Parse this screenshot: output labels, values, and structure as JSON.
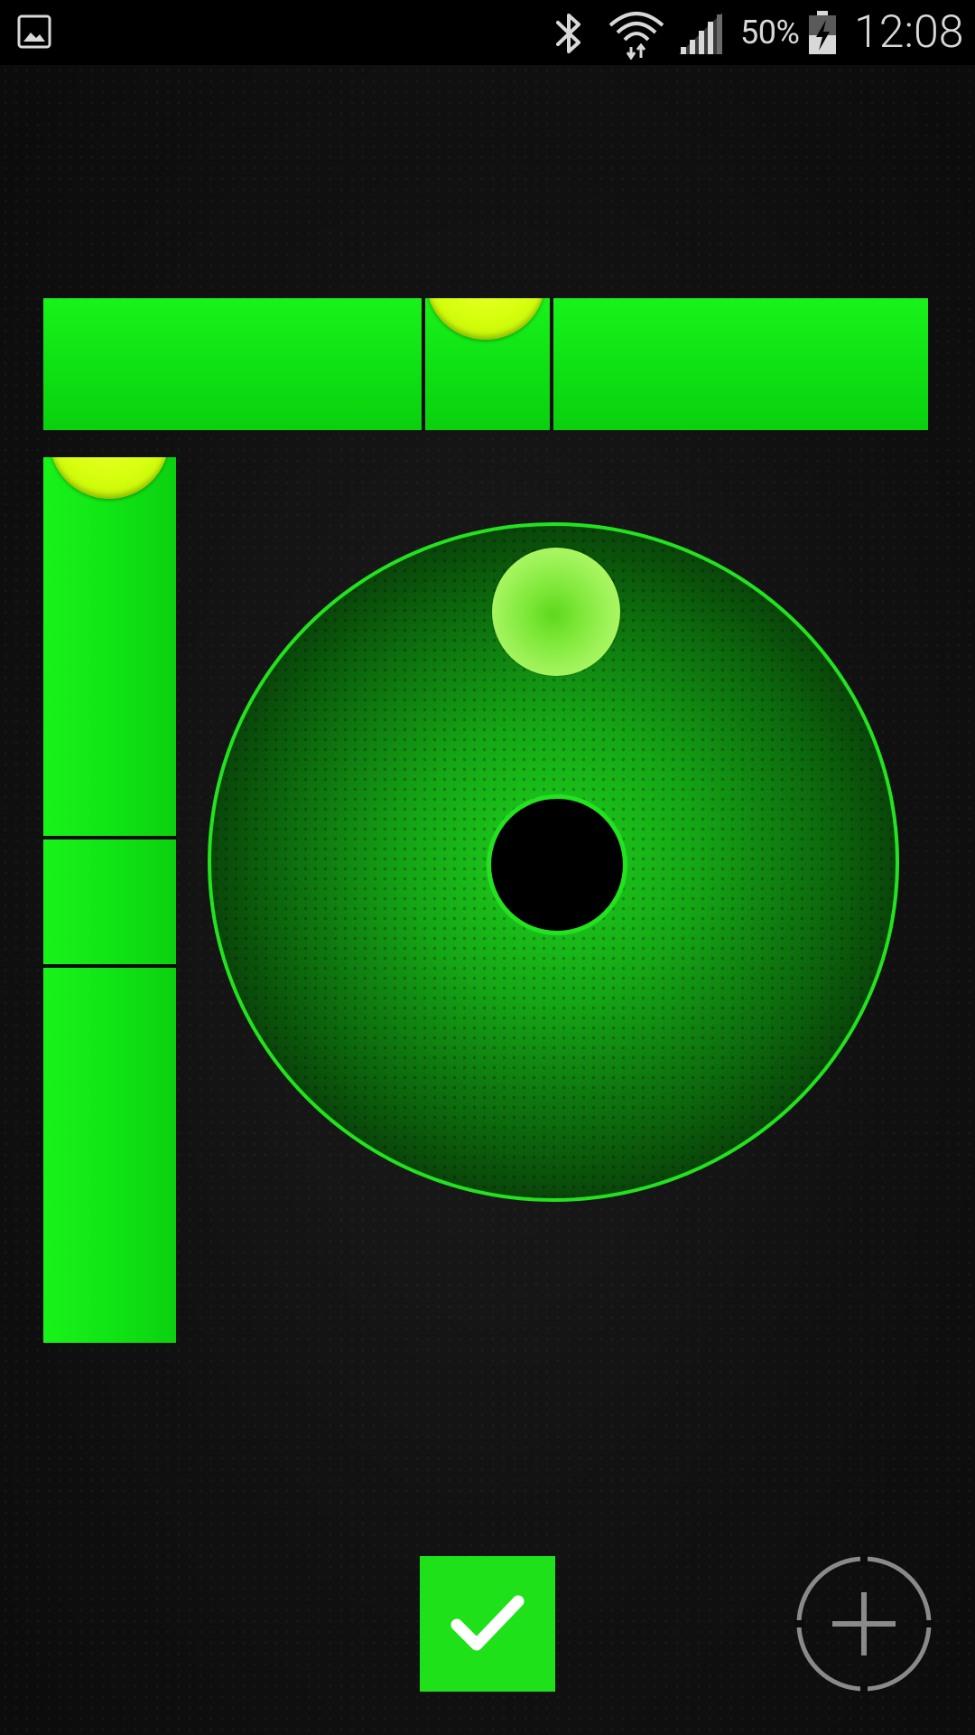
{
  "status_bar": {
    "notification_icon": "gallery-image-icon",
    "bluetooth_icon": "bluetooth-icon",
    "wifi_icon": "wifi-icon",
    "signal_icon": "cellular-signal-icon",
    "battery_percent": "50%",
    "battery_level": 0.5,
    "battery_icon": "battery-charging-icon",
    "clock": "12:08"
  },
  "level": {
    "accent_color": "#1fe11a",
    "bubble_color": "#d8ff0f",
    "horizontal_tube": {
      "icon": "horizontal-level-tube"
    },
    "vertical_tube": {
      "icon": "vertical-level-tube"
    },
    "bullseye": {
      "icon": "bullseye-level"
    }
  },
  "controls": {
    "confirm_icon": "checkmark-icon",
    "calibrate_icon": "crosshair-plus-icon"
  }
}
